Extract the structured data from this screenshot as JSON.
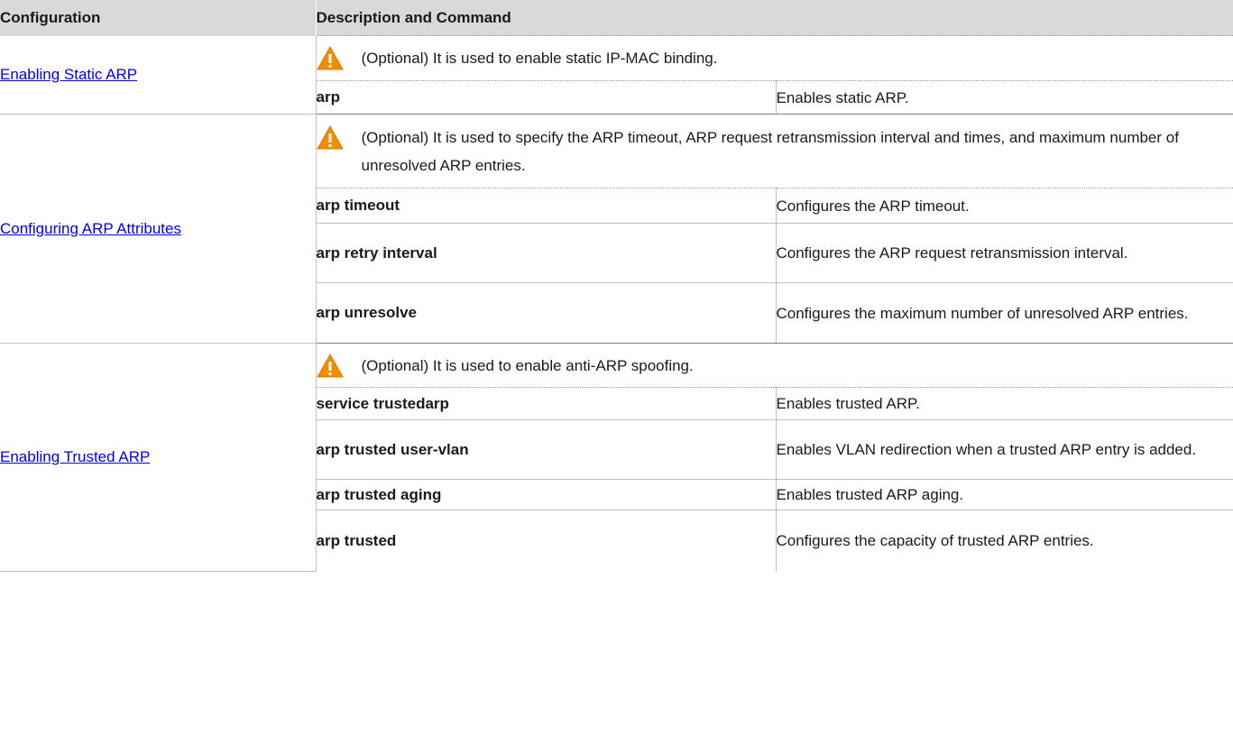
{
  "header": {
    "configuration": "Configuration",
    "description": "Description and Command"
  },
  "groups": [
    {
      "link": "Enabling Static ARP",
      "note": "(Optional) It is used to enable static IP-MAC binding.",
      "commands": [
        {
          "cmd": "arp",
          "desc": "Enables static ARP."
        }
      ]
    },
    {
      "link": "Configuring ARP Attributes",
      "note": "(Optional) It is used to specify the ARP timeout, ARP request retransmission interval and times, and maximum number of unresolved ARP entries.",
      "commands": [
        {
          "cmd": "arp timeout",
          "desc": "Configures the ARP timeout."
        },
        {
          "cmd": "arp retry interval",
          "desc": "Configures the ARP request retransmission interval."
        },
        {
          "cmd": "arp unresolve",
          "desc": "Configures the maximum number of unresolved ARP entries."
        }
      ]
    },
    {
      "link": "Enabling Trusted ARP",
      "note": "(Optional) It is used to enable anti-ARP spoofing.",
      "commands": [
        {
          "cmd": "service trustedarp",
          "desc": "Enables trusted ARP."
        },
        {
          "cmd": "arp trusted user-vlan",
          "desc": "Enables VLAN redirection when a trusted ARP entry is added."
        },
        {
          "cmd": "arp trusted aging",
          "desc": "Enables trusted ARP aging."
        },
        {
          "cmd": "arp trusted",
          "desc": "Configures the capacity of trusted ARP entries."
        }
      ]
    }
  ],
  "icons": {
    "warning": "warning-triangle-icon"
  },
  "colors": {
    "header_bg": "#d9d9d9",
    "link": "#0000ee",
    "warning_fill": "#f08c00"
  }
}
